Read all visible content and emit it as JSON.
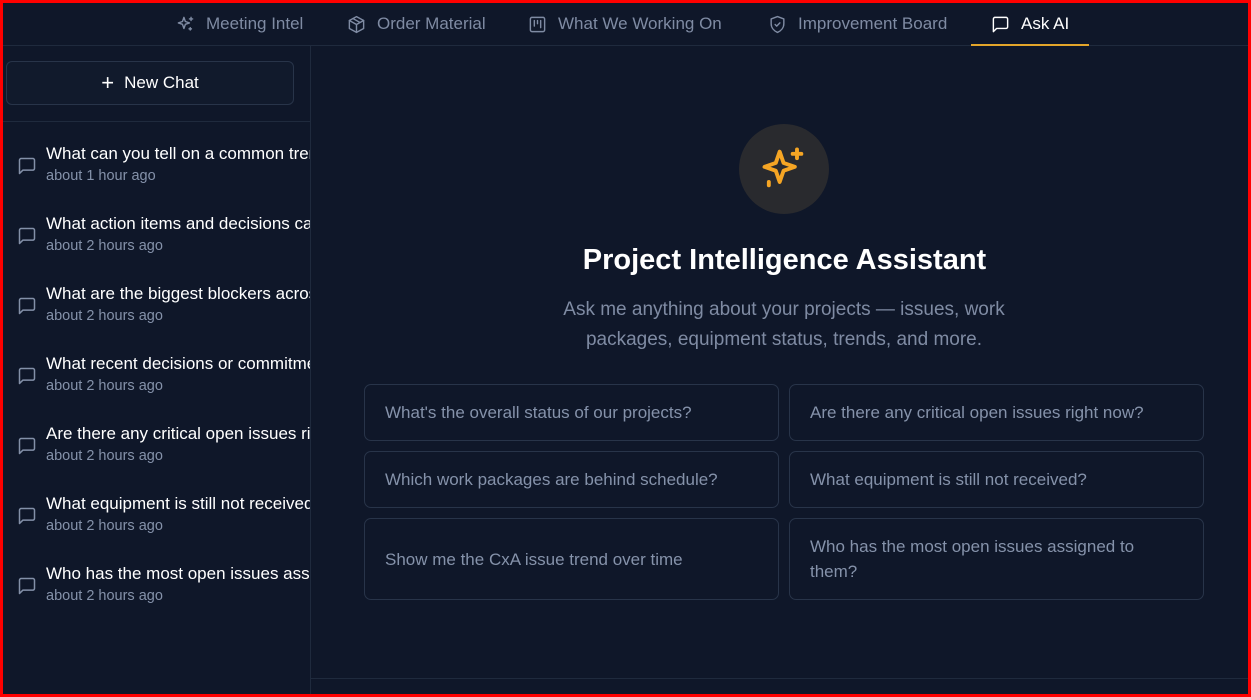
{
  "nav": {
    "tabs": [
      {
        "label": "Meeting Intel",
        "icon": "sparkles-icon"
      },
      {
        "label": "Order Material",
        "icon": "package-icon"
      },
      {
        "label": "What We Working On",
        "icon": "kanban-icon"
      },
      {
        "label": "Improvement Board",
        "icon": "shield-check-icon"
      },
      {
        "label": "Ask AI",
        "icon": "message-square-icon",
        "active": true
      }
    ]
  },
  "sidebar": {
    "new_chat_label": "New Chat",
    "history": [
      {
        "title": "What can you tell on a common trend",
        "time": "about 1 hour ago"
      },
      {
        "title": "What action items and decisions came",
        "time": "about 2 hours ago"
      },
      {
        "title": "What are the biggest blockers across",
        "time": "about 2 hours ago"
      },
      {
        "title": "What recent decisions or commitments",
        "time": "about 2 hours ago"
      },
      {
        "title": "Are there any critical open issues right now?",
        "time": "about 2 hours ago"
      },
      {
        "title": "What equipment is still not received?",
        "time": "about 2 hours ago"
      },
      {
        "title": "Who has the most open issues assigned to them?",
        "time": "about 2 hours ago"
      }
    ]
  },
  "main": {
    "badge_icon": "sparkles-icon",
    "title": "Project Intelligence Assistant",
    "subtitle": "Ask me anything about your projects — issues, work packages, equipment status, trends, and more.",
    "suggestions": [
      "What's the overall status of our projects?",
      "Are there any critical open issues right now?",
      "Which work packages are behind schedule?",
      "What equipment is still not received?",
      "Show me the CxA issue trend over time",
      "Who has the most open issues assigned to them?"
    ]
  },
  "colors": {
    "background": "#0f1729",
    "accent": "#e3a52a",
    "border": "#283449",
    "muted_text": "#7f8ba3"
  }
}
